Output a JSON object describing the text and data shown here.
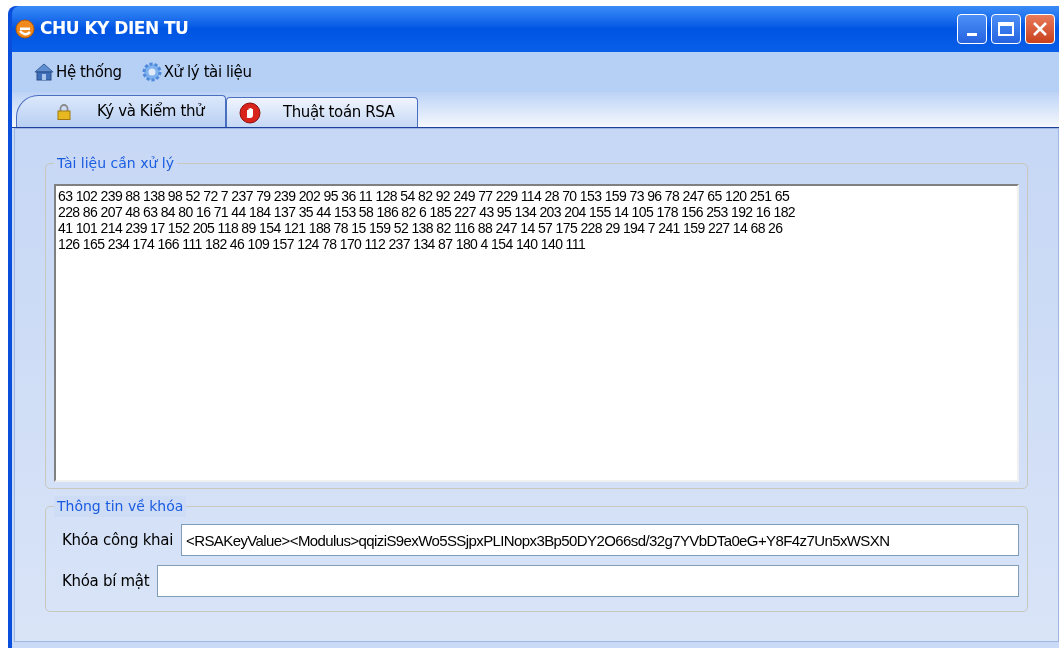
{
  "window": {
    "title": "CHU KY DIEN TU"
  },
  "menu": [
    {
      "label": "Hệ thống",
      "kind": "home"
    },
    {
      "label": "Xử lý tài liệu",
      "kind": "gear"
    }
  ],
  "tabs": [
    {
      "label": "Ký và Kiểm thử",
      "kind": "lock",
      "selected": true
    },
    {
      "label": "Thuật toán RSA",
      "kind": "stop",
      "selected": false
    }
  ],
  "document_group": {
    "title": "Tài liệu cần xử lý",
    "lines": [
      "63 102 239 88 138 98 52 72 7 237 79 239 202 95 36 11 128 54 82 92 249 77 229 114 28 70 153 159 73 96 78 247 65 120 251 65",
      "228 86 207 48 63 84 80 16 71 44 184 137 35 44 153 58 186 82 6 185 227 43 95 134 203 204 155 14 105 178 156 253 192 16 182",
      "41 101 214 239 17 152 205 118 89 154 121 188 78 15 159 52 138 82 116 88 247 14 57 175 228 29 194 7 241 159 227 14 68 26",
      "126 165 234 174 166 111 182 46 109 157 124 78 170 112 237 134 87 180 4 154 140 140 111"
    ]
  },
  "key_group": {
    "title": "Thông tin về khóa",
    "fields": [
      {
        "label": "Khóa công khai",
        "value": "<RSAKeyValue><Modulus>qqiziS9exWo5SSjpxPLINopx3Bp50DY2O66sd/32g7YVbDTa0eG+Y8F4z7Un5xWSXN"
      },
      {
        "label": "Khóa bí mật"
      }
    ]
  }
}
